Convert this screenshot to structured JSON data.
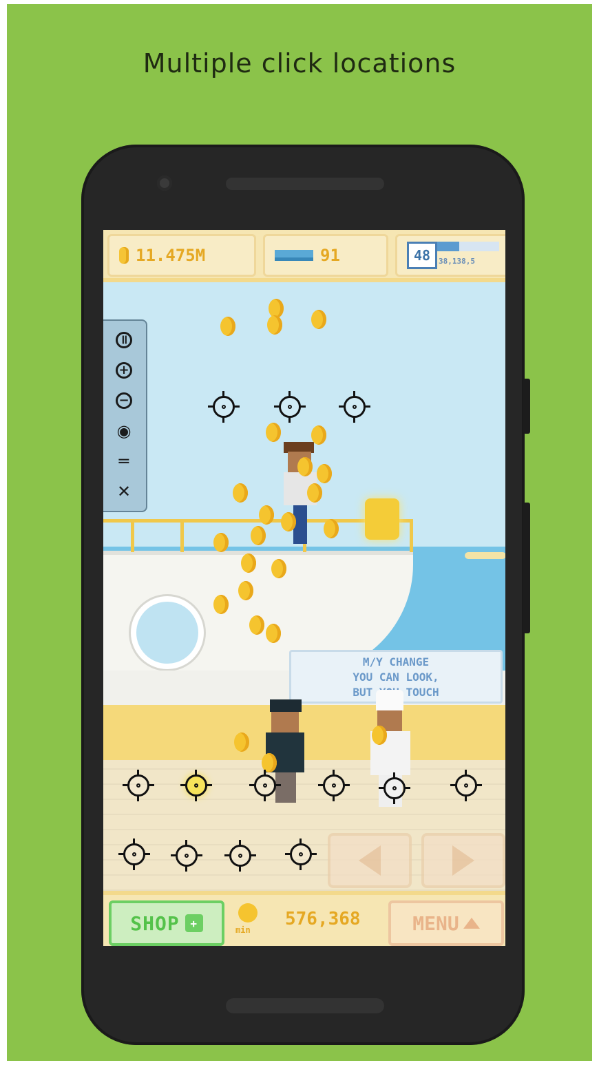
{
  "headline": "Multiple click locations",
  "hud": {
    "money": "11.475M",
    "tickets": "91",
    "level": "48",
    "xp": "38,138,5"
  },
  "sign": {
    "line1": "M/Y CHANGE",
    "line2": "YOU CAN LOOK,",
    "line3": "BUT YOU ",
    "line3b": " TOUCH"
  },
  "toolbar": {
    "pause": "pause-icon",
    "zoom_in": "zoom-in-icon",
    "zoom_out": "zoom-out-icon",
    "eye": "eye-icon",
    "drag": "drag-handle-icon",
    "close": "close-icon"
  },
  "bottom": {
    "shop_label": "SHOP",
    "rate_label": "min",
    "rate_value": "576,368",
    "menu_label": "MENU"
  },
  "colors": {
    "background": "#8bc34a",
    "coin": "#f5c42f",
    "shop_green": "#54c24a"
  }
}
